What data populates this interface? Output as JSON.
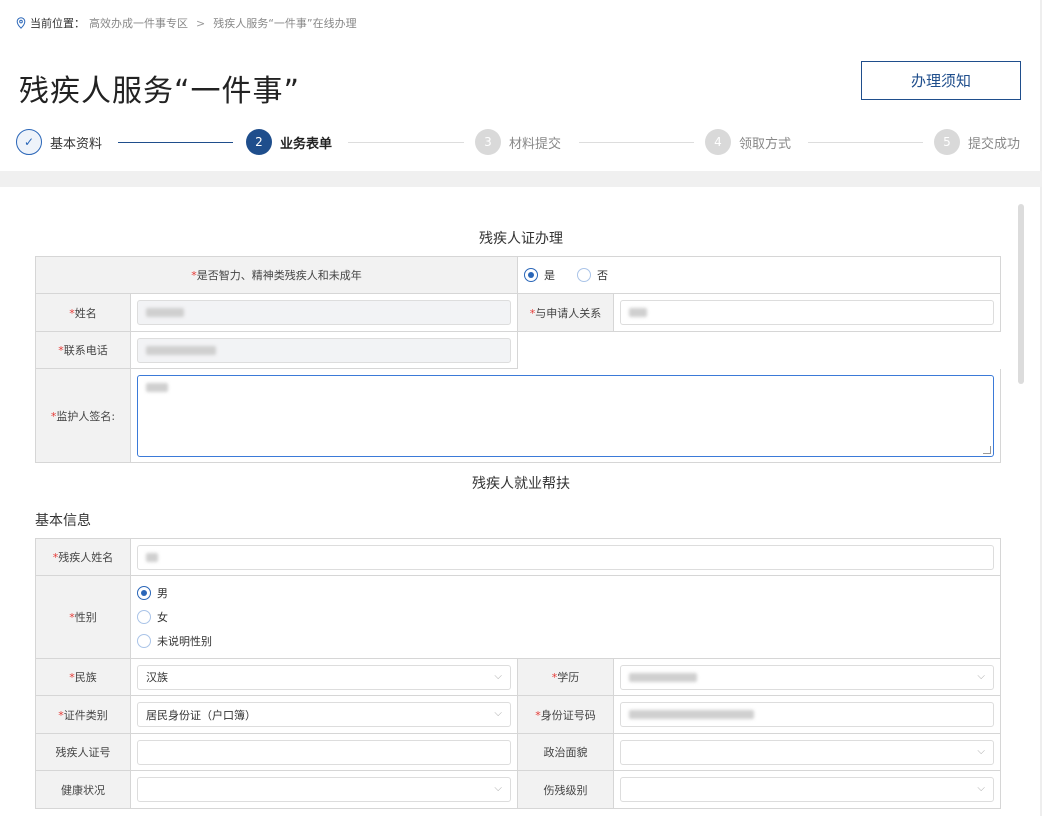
{
  "breadcrumb": {
    "prefix": "当前位置：",
    "items": [
      "高效办成一件事专区",
      "残疾人服务“一件事”在线办理"
    ],
    "separator": ">"
  },
  "page": {
    "title": "残疾人服务“一件事”",
    "notice_button": "办理须知"
  },
  "steps": [
    {
      "num": "✓",
      "label": "基本资料",
      "state": "done"
    },
    {
      "num": "2",
      "label": "业务表单",
      "state": "active"
    },
    {
      "num": "3",
      "label": "材料提交",
      "state": "todo"
    },
    {
      "num": "4",
      "label": "领取方式",
      "state": "todo"
    },
    {
      "num": "5",
      "label": "提交成功",
      "state": "todo"
    }
  ],
  "cert_section": {
    "title": "残疾人证办理",
    "q_intellectual": "是否智力、精神类残疾人和未成年",
    "opt_yes": "是",
    "opt_no": "否",
    "name_label": "姓名",
    "relation_label": "与申请人关系",
    "phone_label": "联系电话",
    "guardian_label": "监护人签名:"
  },
  "employment_section": {
    "title": "残疾人就业帮扶",
    "subhead": "基本信息",
    "name_label": "残疾人姓名",
    "gender_label": "性别",
    "gender_options": [
      "男",
      "女",
      "未说明性别"
    ],
    "ethnicity_label": "民族",
    "ethnicity_value": "汉族",
    "education_label": "学历",
    "id_type_label": "证件类别",
    "id_type_value": "居民身份证（户口簿）",
    "id_number_label": "身份证号码",
    "disability_cert_label": "残疾人证号",
    "political_label": "政治面貌",
    "health_label": "健康状况",
    "disability_level_label": "伤残级别"
  },
  "colors": {
    "accent": "#1f4e8c",
    "required": "#e53935",
    "label_bg": "#f2f2f2"
  }
}
